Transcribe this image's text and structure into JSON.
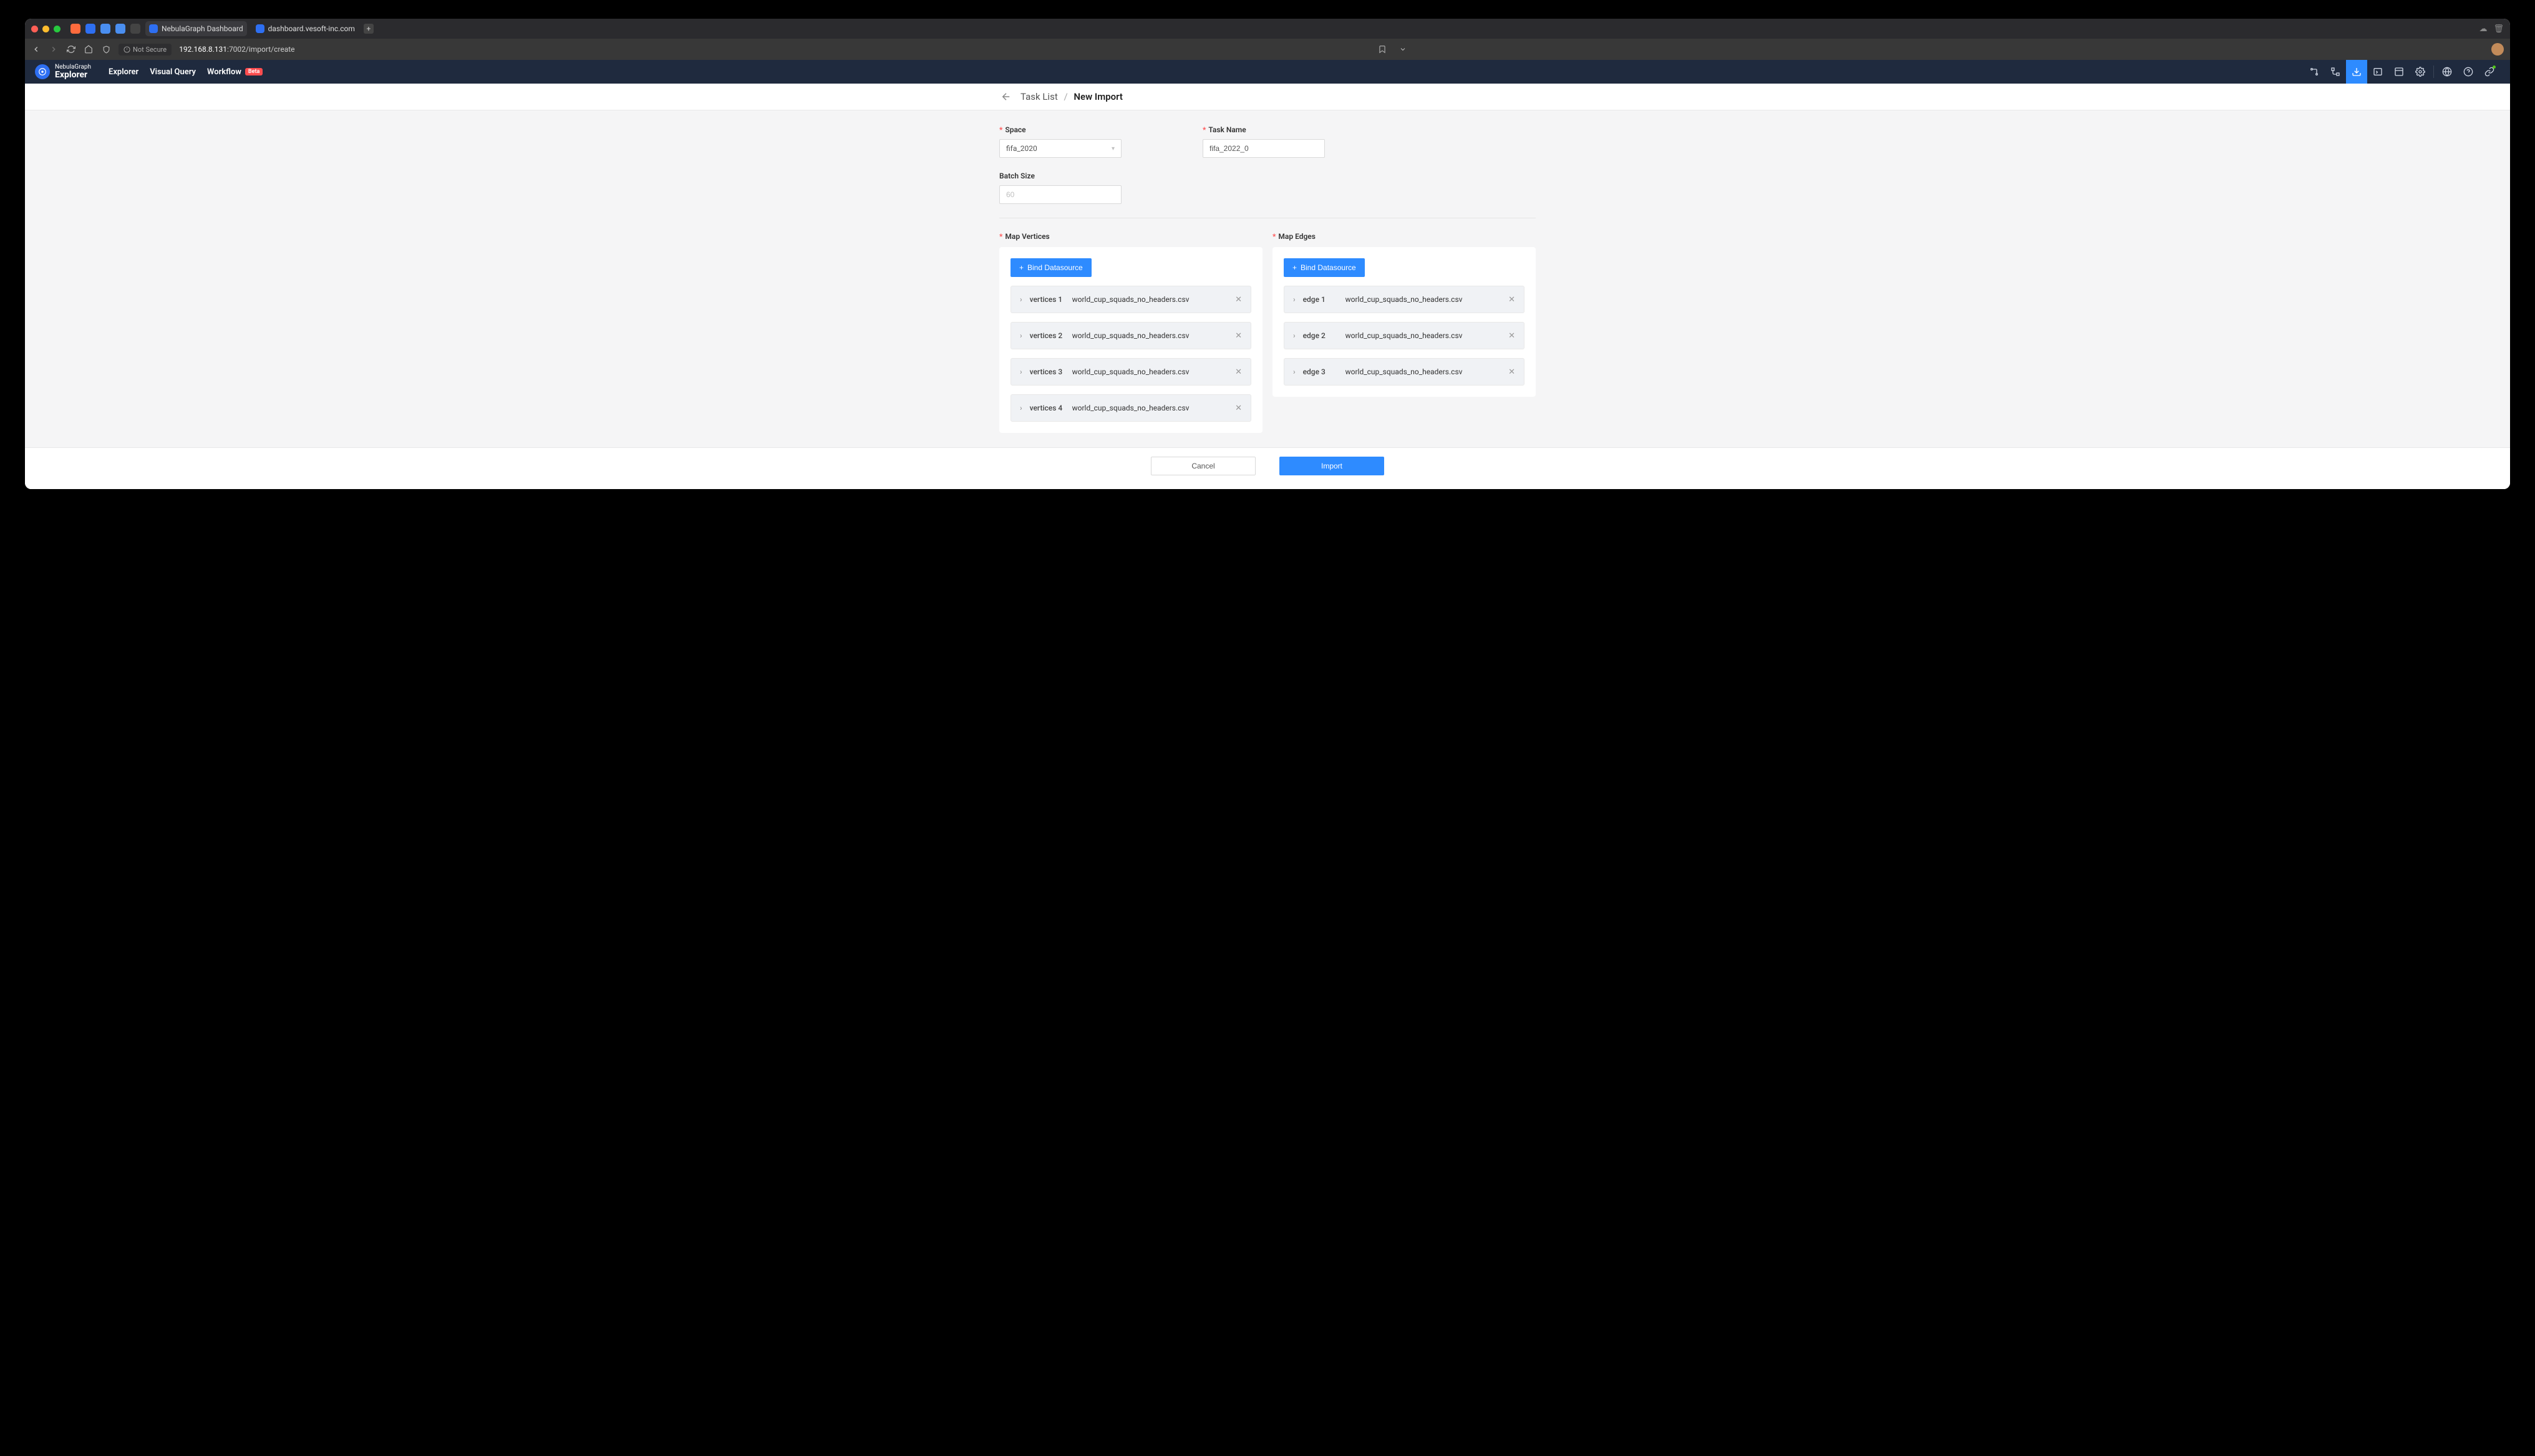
{
  "browser": {
    "tabs": [
      {
        "title": "NebulaGraph Dashboard"
      },
      {
        "title": "dashboard.vesoft-inc.com"
      }
    ],
    "not_secure": "Not Secure",
    "url_host": "192.168.8.131",
    "url_path": ":7002/import/create"
  },
  "app": {
    "brand_top": "NebulaGraph",
    "brand_main": "Explorer",
    "nav": {
      "explorer": "Explorer",
      "visual_query": "Visual Query",
      "workflow": "Workflow",
      "beta": "Beta"
    }
  },
  "breadcrumb": {
    "parent": "Task List",
    "current": "New Import"
  },
  "form": {
    "space_label": "Space",
    "space_value": "fifa_2020",
    "task_label": "Task Name",
    "task_value": "fifa_2022_0",
    "batch_label": "Batch Size",
    "batch_placeholder": "60"
  },
  "vertices": {
    "label": "Map Vertices",
    "bind_button": "Bind Datasource",
    "items": [
      {
        "name": "vertices 1",
        "file": "world_cup_squads_no_headers.csv"
      },
      {
        "name": "vertices 2",
        "file": "world_cup_squads_no_headers.csv"
      },
      {
        "name": "vertices 3",
        "file": "world_cup_squads_no_headers.csv"
      },
      {
        "name": "vertices 4",
        "file": "world_cup_squads_no_headers.csv"
      }
    ]
  },
  "edges": {
    "label": "Map Edges",
    "bind_button": "Bind Datasource",
    "items": [
      {
        "name": "edge 1",
        "file": "world_cup_squads_no_headers.csv"
      },
      {
        "name": "edge 2",
        "file": "world_cup_squads_no_headers.csv"
      },
      {
        "name": "edge 3",
        "file": "world_cup_squads_no_headers.csv"
      }
    ]
  },
  "footer": {
    "cancel": "Cancel",
    "import": "Import"
  }
}
